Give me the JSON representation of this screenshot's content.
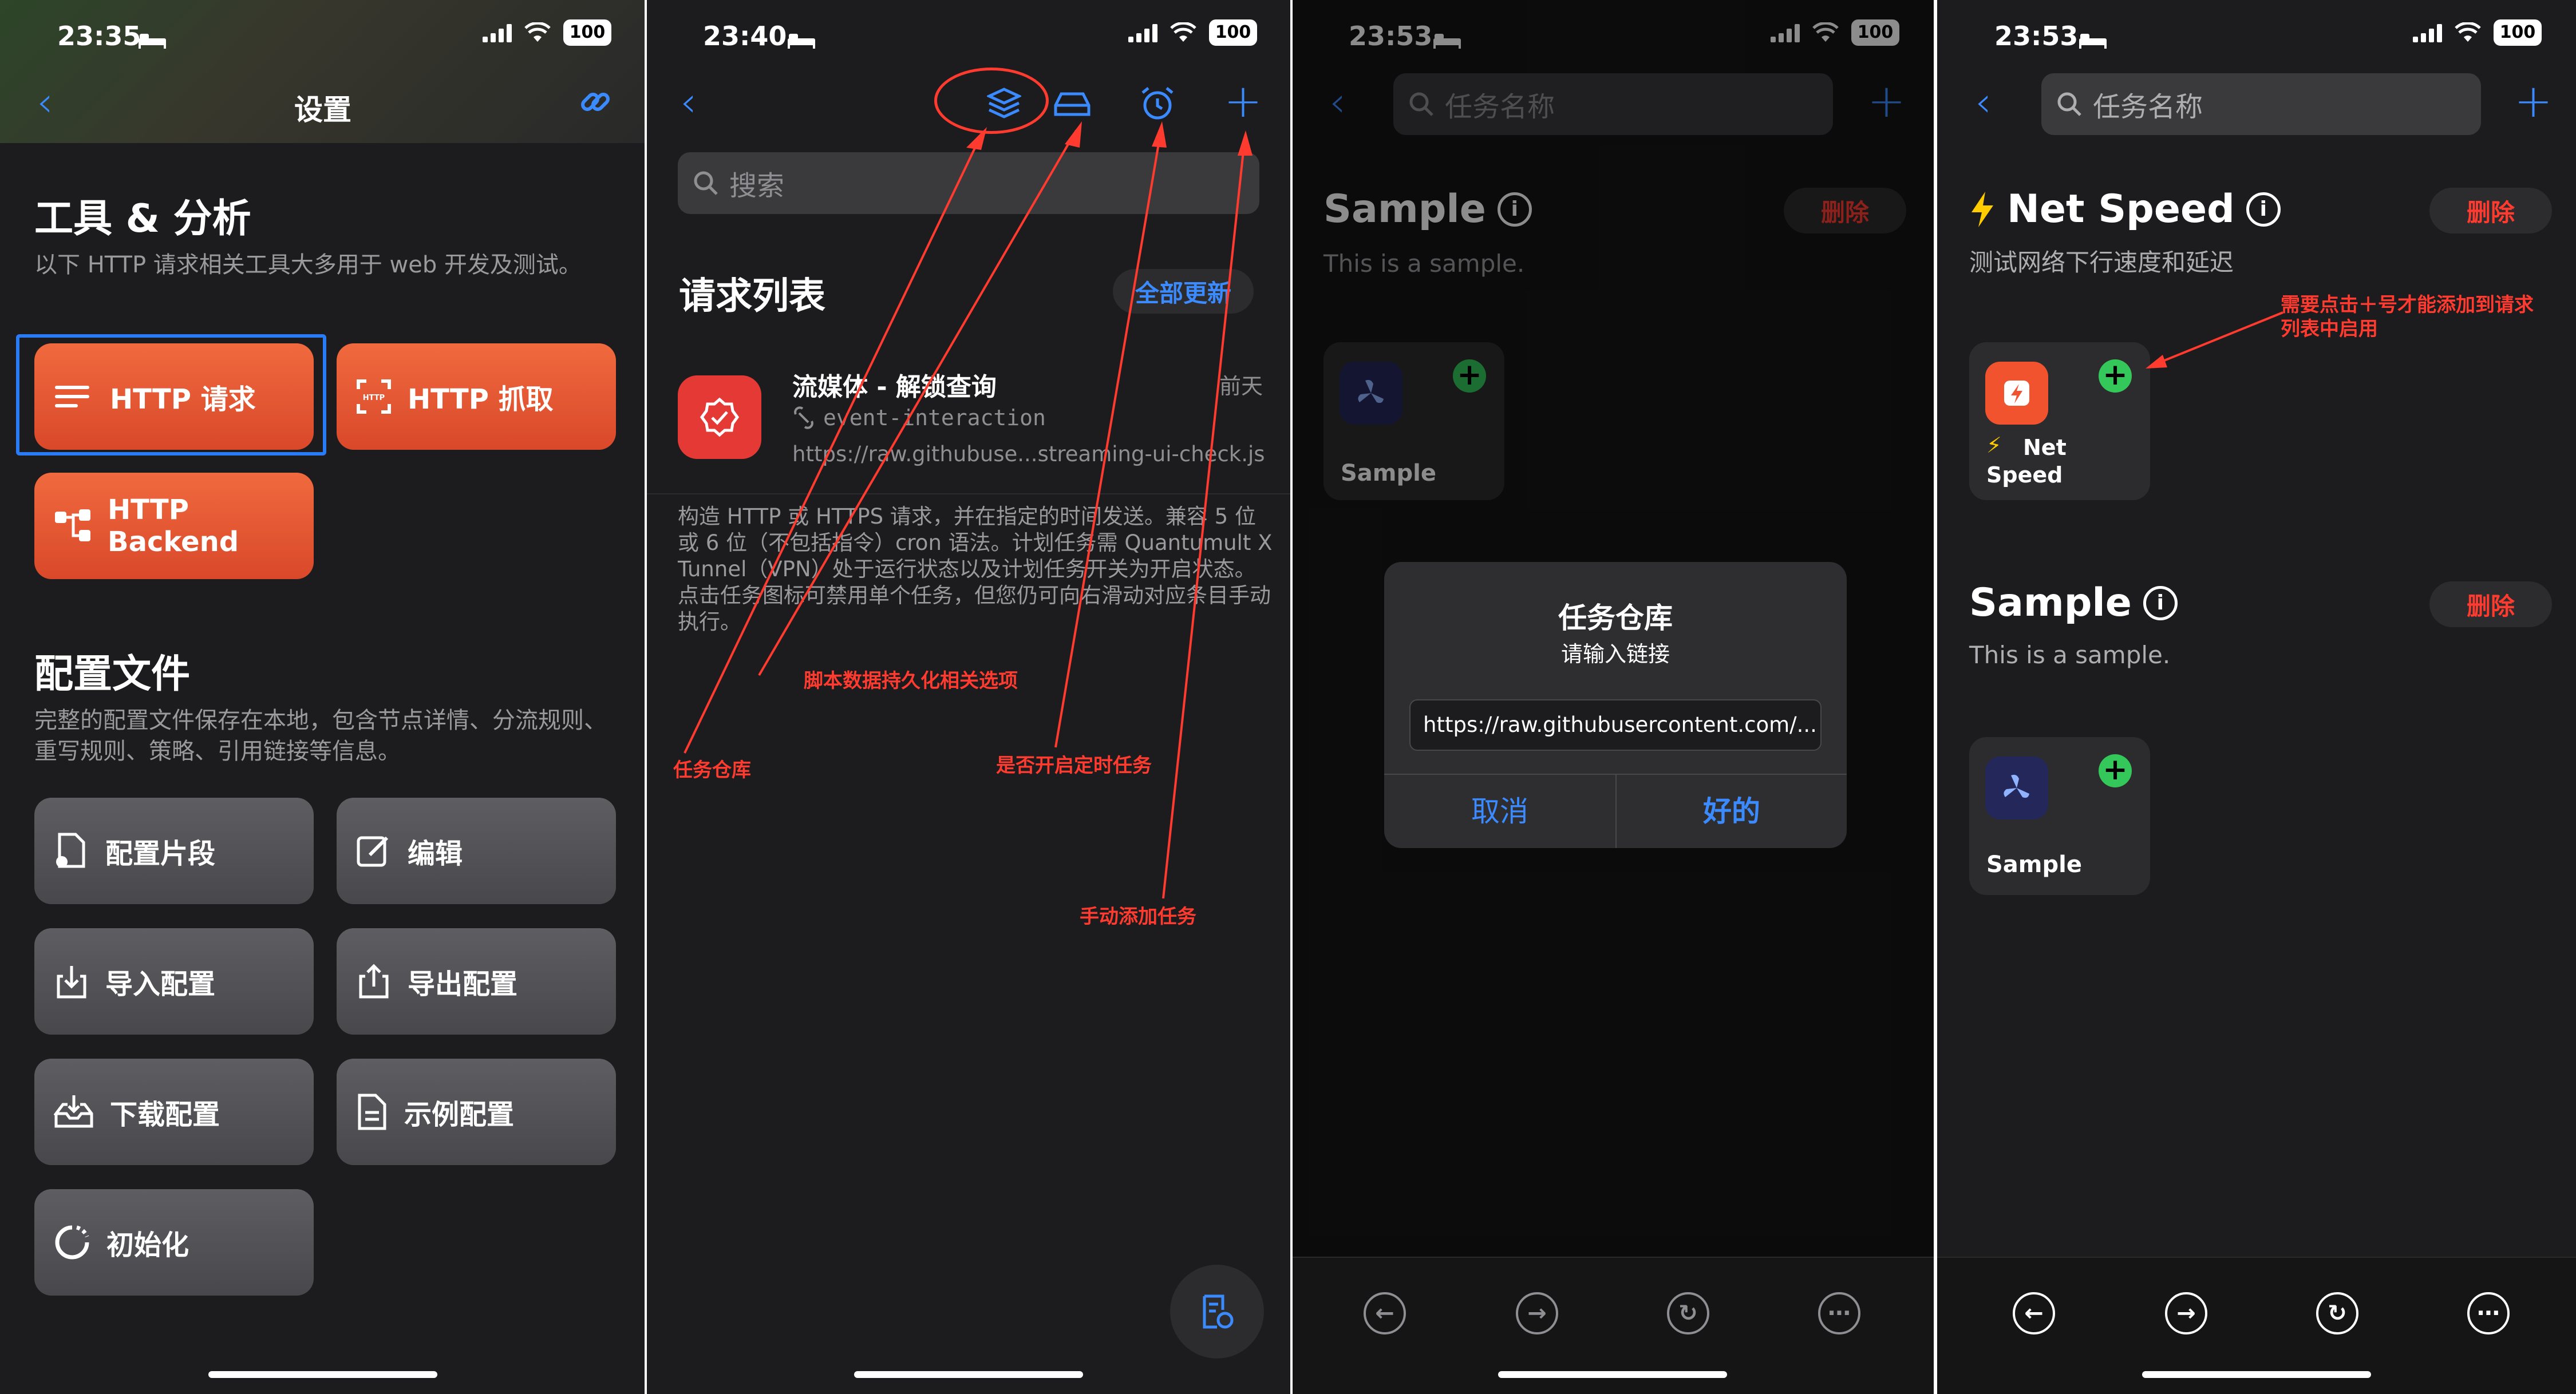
{
  "panel1": {
    "time": "23:35",
    "battery": "100",
    "nav_title": "设置",
    "tools_heading": "工具 & 分析",
    "tools_desc": "以下 HTTP 请求相关工具大多用于 web 开发及测试。",
    "btn_http_request": "HTTP 请求",
    "btn_http_capture": "HTTP 抓取",
    "btn_http_backend": "HTTP Backend",
    "config_heading": "配置文件",
    "config_desc": "完整的配置文件保存在本地，包含节点详情、分流规则、重写规则、策略、引用链接等信息。",
    "btn_snippet": "配置片段",
    "btn_edit": "编辑",
    "btn_import": "导入配置",
    "btn_export": "导出配置",
    "btn_download": "下载配置",
    "btn_example": "示例配置",
    "btn_init": "初始化"
  },
  "panel2": {
    "time": "23:40",
    "battery": "100",
    "search_placeholder": "搜索",
    "list_title": "请求列表",
    "update_all": "全部更新",
    "item_title": "流媒体 - 解锁查询",
    "item_tag": "event-interaction",
    "item_url": "https://raw.githubuse...streaming-ui-check.js",
    "item_time": "前天",
    "info_text": "构造 HTTP 或 HTTPS 请求，并在指定的时间发送。兼容 5 位或 6 位（不包括指令）cron 语法。计划任务需 Quantumult X Tunnel（VPN）处于运行状态以及计划任务开关为开启状态。点击任务图标可禁用单个任务，但您仍可向右滑动对应条目手动执行。",
    "anno_repo": "任务仓库",
    "anno_persist": "脚本数据持久化相关选项",
    "anno_timer": "是否开启定时任务",
    "anno_manual": "手动添加任务"
  },
  "panel3": {
    "time": "23:53",
    "battery": "100",
    "search_placeholder": "任务名称",
    "section_title": "Sample",
    "delete_label": "删除",
    "section_desc": "This is a sample.",
    "tile_label": "Sample",
    "dialog_title": "任务仓库",
    "dialog_subtitle": "请输入链接",
    "dialog_input": "https://raw.githubusercontent.com/...",
    "dialog_cancel": "取消",
    "dialog_ok": "好的"
  },
  "panel4": {
    "time": "23:53",
    "battery": "100",
    "search_placeholder": "任务名称",
    "section1_title": "Net Speed",
    "section1_desc": "测试网络下行速度和延迟",
    "delete_label": "删除",
    "tile1_label": "Net Speed",
    "anno_add": "需要点击＋号才能添加到请求列表中启用",
    "section2_title": "Sample",
    "section2_desc": "This is a sample.",
    "tile2_label": "Sample"
  },
  "colors": {
    "accent_blue": "#3b8bff",
    "orange": "#e8573a",
    "annotation_red": "#ff3b30",
    "add_green": "#34c759"
  }
}
